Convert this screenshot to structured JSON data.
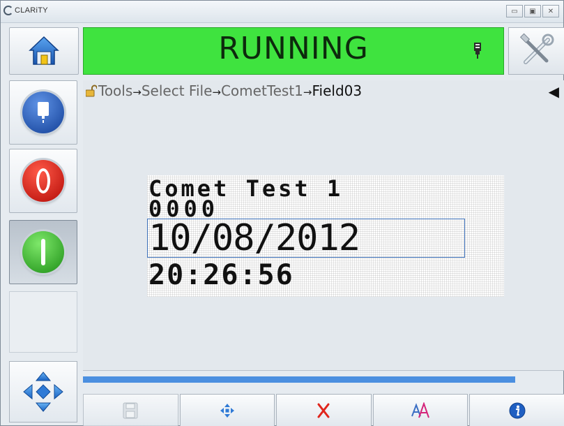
{
  "app": {
    "name": "CLARiTY",
    "window_controls": [
      "minimize",
      "maximize",
      "close"
    ]
  },
  "status": {
    "text": "RUNNING",
    "color": "#3fe33f",
    "icon": "printhead-icon"
  },
  "breadcrumb": {
    "lock_icon": "unlocked-padlock-icon",
    "items": [
      "Tools",
      "Select File",
      "CometTest1",
      "Field03"
    ],
    "separator": "→"
  },
  "back_button": {
    "icon": "back-arrow-icon",
    "glyph": "◀"
  },
  "left_buttons": [
    {
      "name": "ink-button",
      "icon": "ink-cartridge-icon",
      "color": "#1d57b5"
    },
    {
      "name": "stop-button",
      "icon": "stop-icon",
      "color": "#d8140c"
    },
    {
      "name": "start-button",
      "icon": "start-icon",
      "color": "#2fbe22",
      "pressed": true
    }
  ],
  "label_preview": {
    "lines": [
      "Comet Test 1",
      "0000",
      "10/08/2012",
      "20:26:56"
    ],
    "selected_line": 2
  },
  "progress": {
    "fraction": 0.997,
    "color": "#4b8fe0"
  },
  "bottom_bar": [
    {
      "name": "save-button",
      "icon": "floppy-disk-icon",
      "enabled": false
    },
    {
      "name": "move-field-button",
      "icon": "four-way-arrows-icon",
      "enabled": true
    },
    {
      "name": "delete-button",
      "icon": "red-x-icon",
      "enabled": true
    },
    {
      "name": "font-button",
      "icon": "font-size-icon",
      "enabled": true
    },
    {
      "name": "info-button",
      "icon": "info-icon",
      "enabled": true
    }
  ]
}
